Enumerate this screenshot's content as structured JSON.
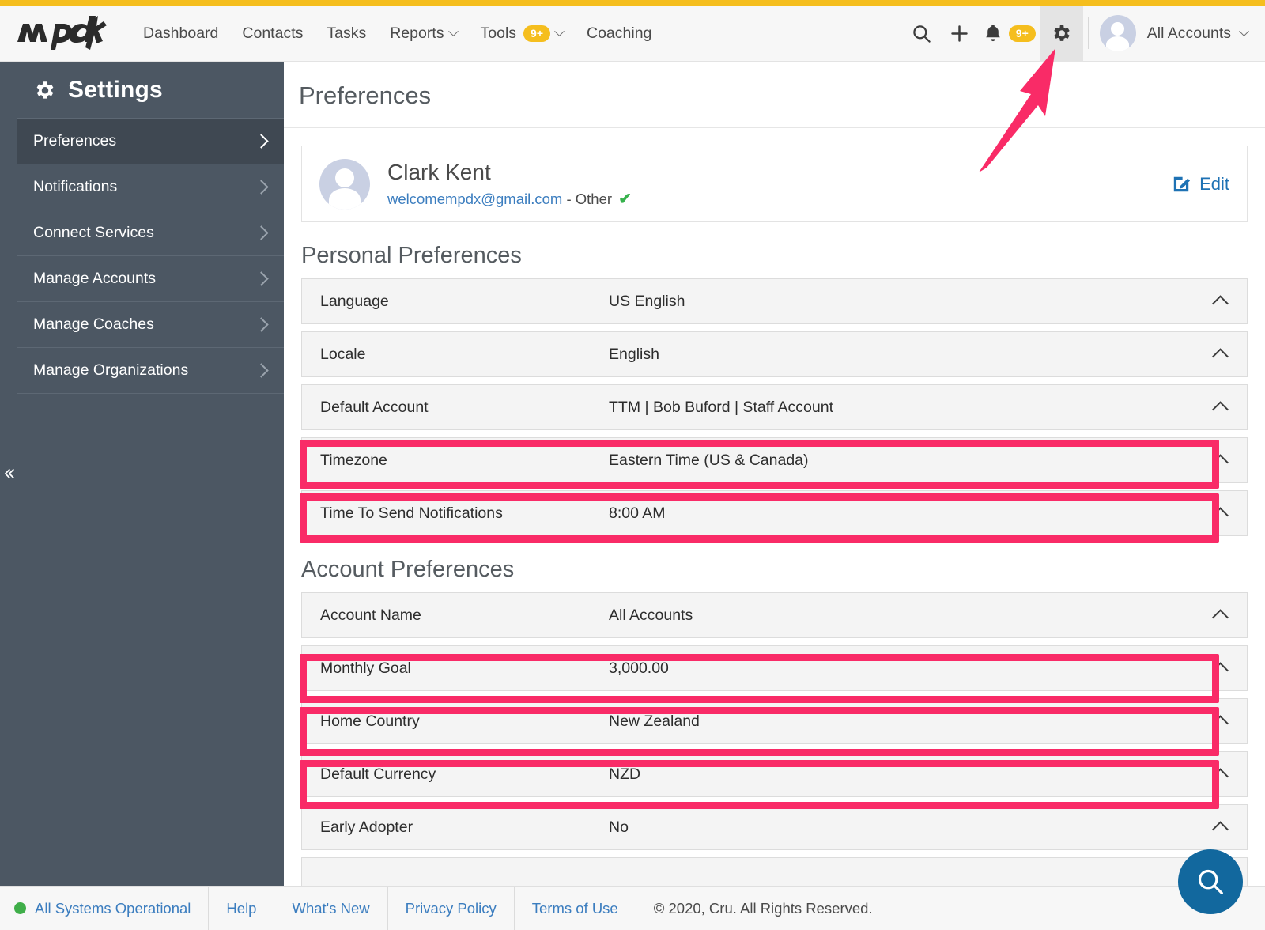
{
  "brand": {
    "name": "mpdx",
    "logo_icon": "mpdx-logo"
  },
  "navbar": {
    "links": [
      {
        "label": "Dashboard",
        "has_caret": false,
        "badge": null
      },
      {
        "label": "Contacts",
        "has_caret": false,
        "badge": null
      },
      {
        "label": "Tasks",
        "has_caret": false,
        "badge": null
      },
      {
        "label": "Reports",
        "has_caret": true,
        "badge": null
      },
      {
        "label": "Tools",
        "has_caret": true,
        "badge": "9+"
      },
      {
        "label": "Coaching",
        "has_caret": false,
        "badge": null
      }
    ],
    "search_icon": "search-icon",
    "add_icon": "plus-icon",
    "bell_icon": "bell-icon",
    "bell_badge": "9+",
    "settings_icon": "gear-icon",
    "account_label": "All Accounts",
    "account_caret_icon": "chevron-down-icon"
  },
  "sidebar": {
    "title": "Settings",
    "title_icon": "gear-icon",
    "collapse_icon": "double-chevron-left-icon",
    "items": [
      {
        "label": "Preferences",
        "selected": true
      },
      {
        "label": "Notifications",
        "selected": false
      },
      {
        "label": "Connect Services",
        "selected": false
      },
      {
        "label": "Manage Accounts",
        "selected": false
      },
      {
        "label": "Manage Coaches",
        "selected": false
      },
      {
        "label": "Manage Organizations",
        "selected": false
      }
    ]
  },
  "main": {
    "page_title": "Preferences",
    "profile": {
      "name": "Clark Kent",
      "email": "welcomempdx@gmail.com",
      "email_type": " - Other ",
      "verified_icon": "check-icon",
      "avatar_icon": "avatar",
      "edit_label": "Edit",
      "edit_icon": "edit-pencil-icon"
    },
    "personal_preferences": {
      "heading": "Personal Preferences",
      "rows": [
        {
          "label": "Language",
          "value": "US English",
          "highlighted": false
        },
        {
          "label": "Locale",
          "value": "English",
          "highlighted": false
        },
        {
          "label": "Default Account",
          "value": "TTM | Bob Buford | Staff Account",
          "highlighted": false
        },
        {
          "label": "Timezone",
          "value": "Eastern Time (US & Canada)",
          "highlighted": true
        },
        {
          "label": "Time To Send Notifications",
          "value": "8:00 AM",
          "highlighted": true
        }
      ]
    },
    "account_preferences": {
      "heading": "Account Preferences",
      "rows": [
        {
          "label": "Account Name",
          "value": "All Accounts",
          "highlighted": false
        },
        {
          "label": "Monthly Goal",
          "value": "3,000.00",
          "highlighted": true
        },
        {
          "label": "Home Country",
          "value": "New Zealand",
          "highlighted": true
        },
        {
          "label": "Default Currency",
          "value": "NZD",
          "highlighted": true
        },
        {
          "label": "Early Adopter",
          "value": "No",
          "highlighted": false
        }
      ]
    },
    "row_collapse_icon": "chevron-up-icon",
    "help_fab_icon": "search-icon"
  },
  "annotations": {
    "color": "#F92B67",
    "arrow_target": "gear-icon",
    "arrow_icon": "pink-arrow-up-right"
  },
  "footer": {
    "status_label": "All Systems Operational",
    "status_dot_color": "#3FAE49",
    "links": [
      {
        "label": "Help"
      },
      {
        "label": "What's New"
      },
      {
        "label": "Privacy Policy"
      },
      {
        "label": "Terms of Use"
      }
    ],
    "copyright": "© 2020, Cru. All Rights Reserved."
  }
}
